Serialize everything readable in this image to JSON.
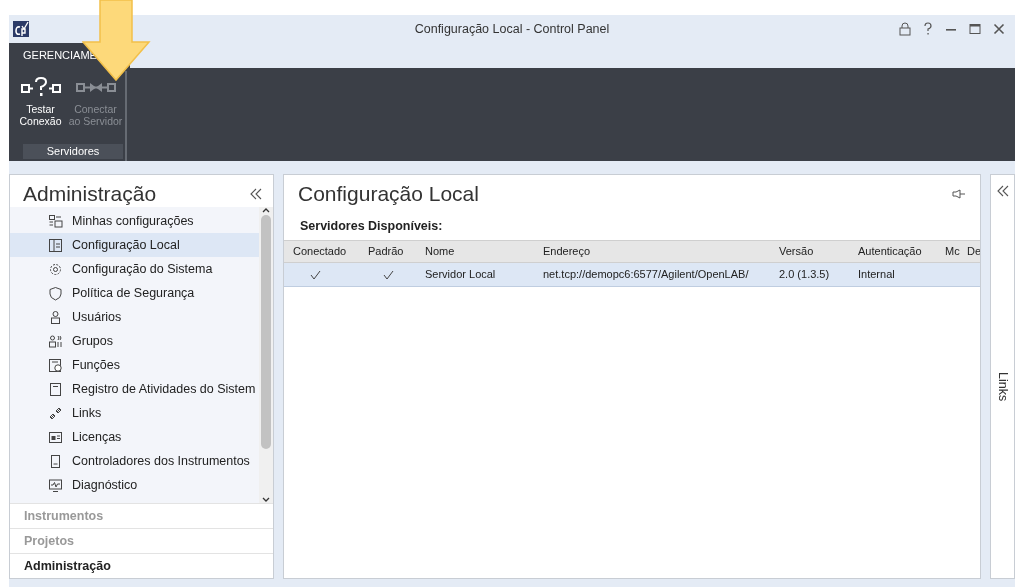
{
  "window": {
    "title": "Configuração Local - Control Panel"
  },
  "ribbon": {
    "tabs": [
      {
        "label": "GERENCIAME",
        "selected": true
      }
    ],
    "groups": [
      {
        "label": "Servidores",
        "buttons": [
          {
            "label": "Testar Conexão",
            "disabled": false
          },
          {
            "label": "Conectar ao Servidor",
            "disabled": true
          }
        ]
      }
    ]
  },
  "sidebar": {
    "title": "Administração",
    "items": [
      {
        "label": "Minhas configurações",
        "selected": false
      },
      {
        "label": "Configuração Local",
        "selected": true
      },
      {
        "label": "Configuração do Sistema",
        "selected": false
      },
      {
        "label": "Política de Segurança",
        "selected": false
      },
      {
        "label": "Usuários",
        "selected": false
      },
      {
        "label": "Grupos",
        "selected": false
      },
      {
        "label": "Funções",
        "selected": false
      },
      {
        "label": "Registro de Atividades do Sistem",
        "selected": false
      },
      {
        "label": "Links",
        "selected": false
      },
      {
        "label": "Licenças",
        "selected": false
      },
      {
        "label": "Controladores dos Instrumentos",
        "selected": false
      },
      {
        "label": "Diagnóstico",
        "selected": false
      }
    ],
    "sections": [
      {
        "label": "Instrumentos",
        "selected": false
      },
      {
        "label": "Projetos",
        "selected": false
      },
      {
        "label": "Administração",
        "selected": true
      }
    ]
  },
  "content": {
    "title": "Configuração Local",
    "subtitle": "Servidores Disponíveis:",
    "table": {
      "columns": [
        "Conectado",
        "Padrão",
        "Nome",
        "Endereço",
        "Versão",
        "Autenticação",
        "Mc",
        "De"
      ],
      "rows": [
        {
          "selected": true,
          "connected": true,
          "default": true,
          "cells": [
            "",
            "",
            "Servidor Local",
            "net.tcp://demopc6:6577/Agilent/OpenLAB/",
            "2.0 (1.3.5)",
            "Internal"
          ]
        }
      ]
    }
  },
  "links_panel": {
    "label": "Links"
  }
}
